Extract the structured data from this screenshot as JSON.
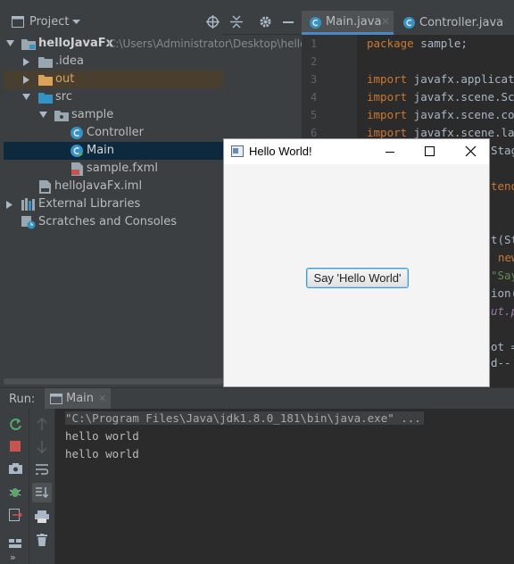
{
  "project_panel": {
    "header_label": "Project",
    "tree": [
      {
        "label": "helloJavaFx",
        "path": "C:\\Users\\Administrator\\Desktop\\hello"
      },
      {
        "label": ".idea"
      },
      {
        "label": "out"
      },
      {
        "label": "src"
      },
      {
        "label": "sample"
      },
      {
        "label": "Controller"
      },
      {
        "label": "Main"
      },
      {
        "label": "sample.fxml"
      },
      {
        "label": "helloJavaFx.iml"
      },
      {
        "label": "External Libraries"
      },
      {
        "label": "Scratches and Consoles"
      }
    ]
  },
  "editor": {
    "tabs": [
      {
        "label": "Main.java",
        "active": true
      },
      {
        "label": "Controller.java",
        "active": false
      }
    ],
    "line_numbers": [
      "1",
      "2",
      "3",
      "4",
      "5",
      "6"
    ],
    "code_lines": [
      {
        "kw": "package",
        "text": " sample;"
      },
      {
        "kw": "",
        "text": ""
      },
      {
        "kw": "import",
        "text": " javafx.applicatio"
      },
      {
        "kw": "import",
        "text": " javafx.scene.Scen"
      },
      {
        "kw": "import",
        "text": " javafx.scene.cont"
      },
      {
        "kw": "import",
        "text": " javafx.scene.layo"
      }
    ],
    "fragments": [
      "Stag",
      "tend",
      "t(St",
      "new",
      "\"Say",
      "ion(",
      "ut.p",
      "ot =",
      "d--"
    ]
  },
  "run_panel": {
    "label": "Run:",
    "tab_label": "Main",
    "console_lines": [
      "\"C:\\Program Files\\Java\\jdk1.8.0_181\\bin\\java.exe\" ...",
      "hello world",
      "hello world"
    ]
  },
  "fx_window": {
    "title": "Hello World!",
    "button_label": "Say 'Hello World'"
  },
  "colors": {
    "ide_background": "#3c3f41",
    "editor_background": "#2b2b2b",
    "keyword": "#cc7832",
    "selection": "#0d293e",
    "folder_blue": "#3592c4",
    "excluded_orange": "#d9a35a"
  }
}
